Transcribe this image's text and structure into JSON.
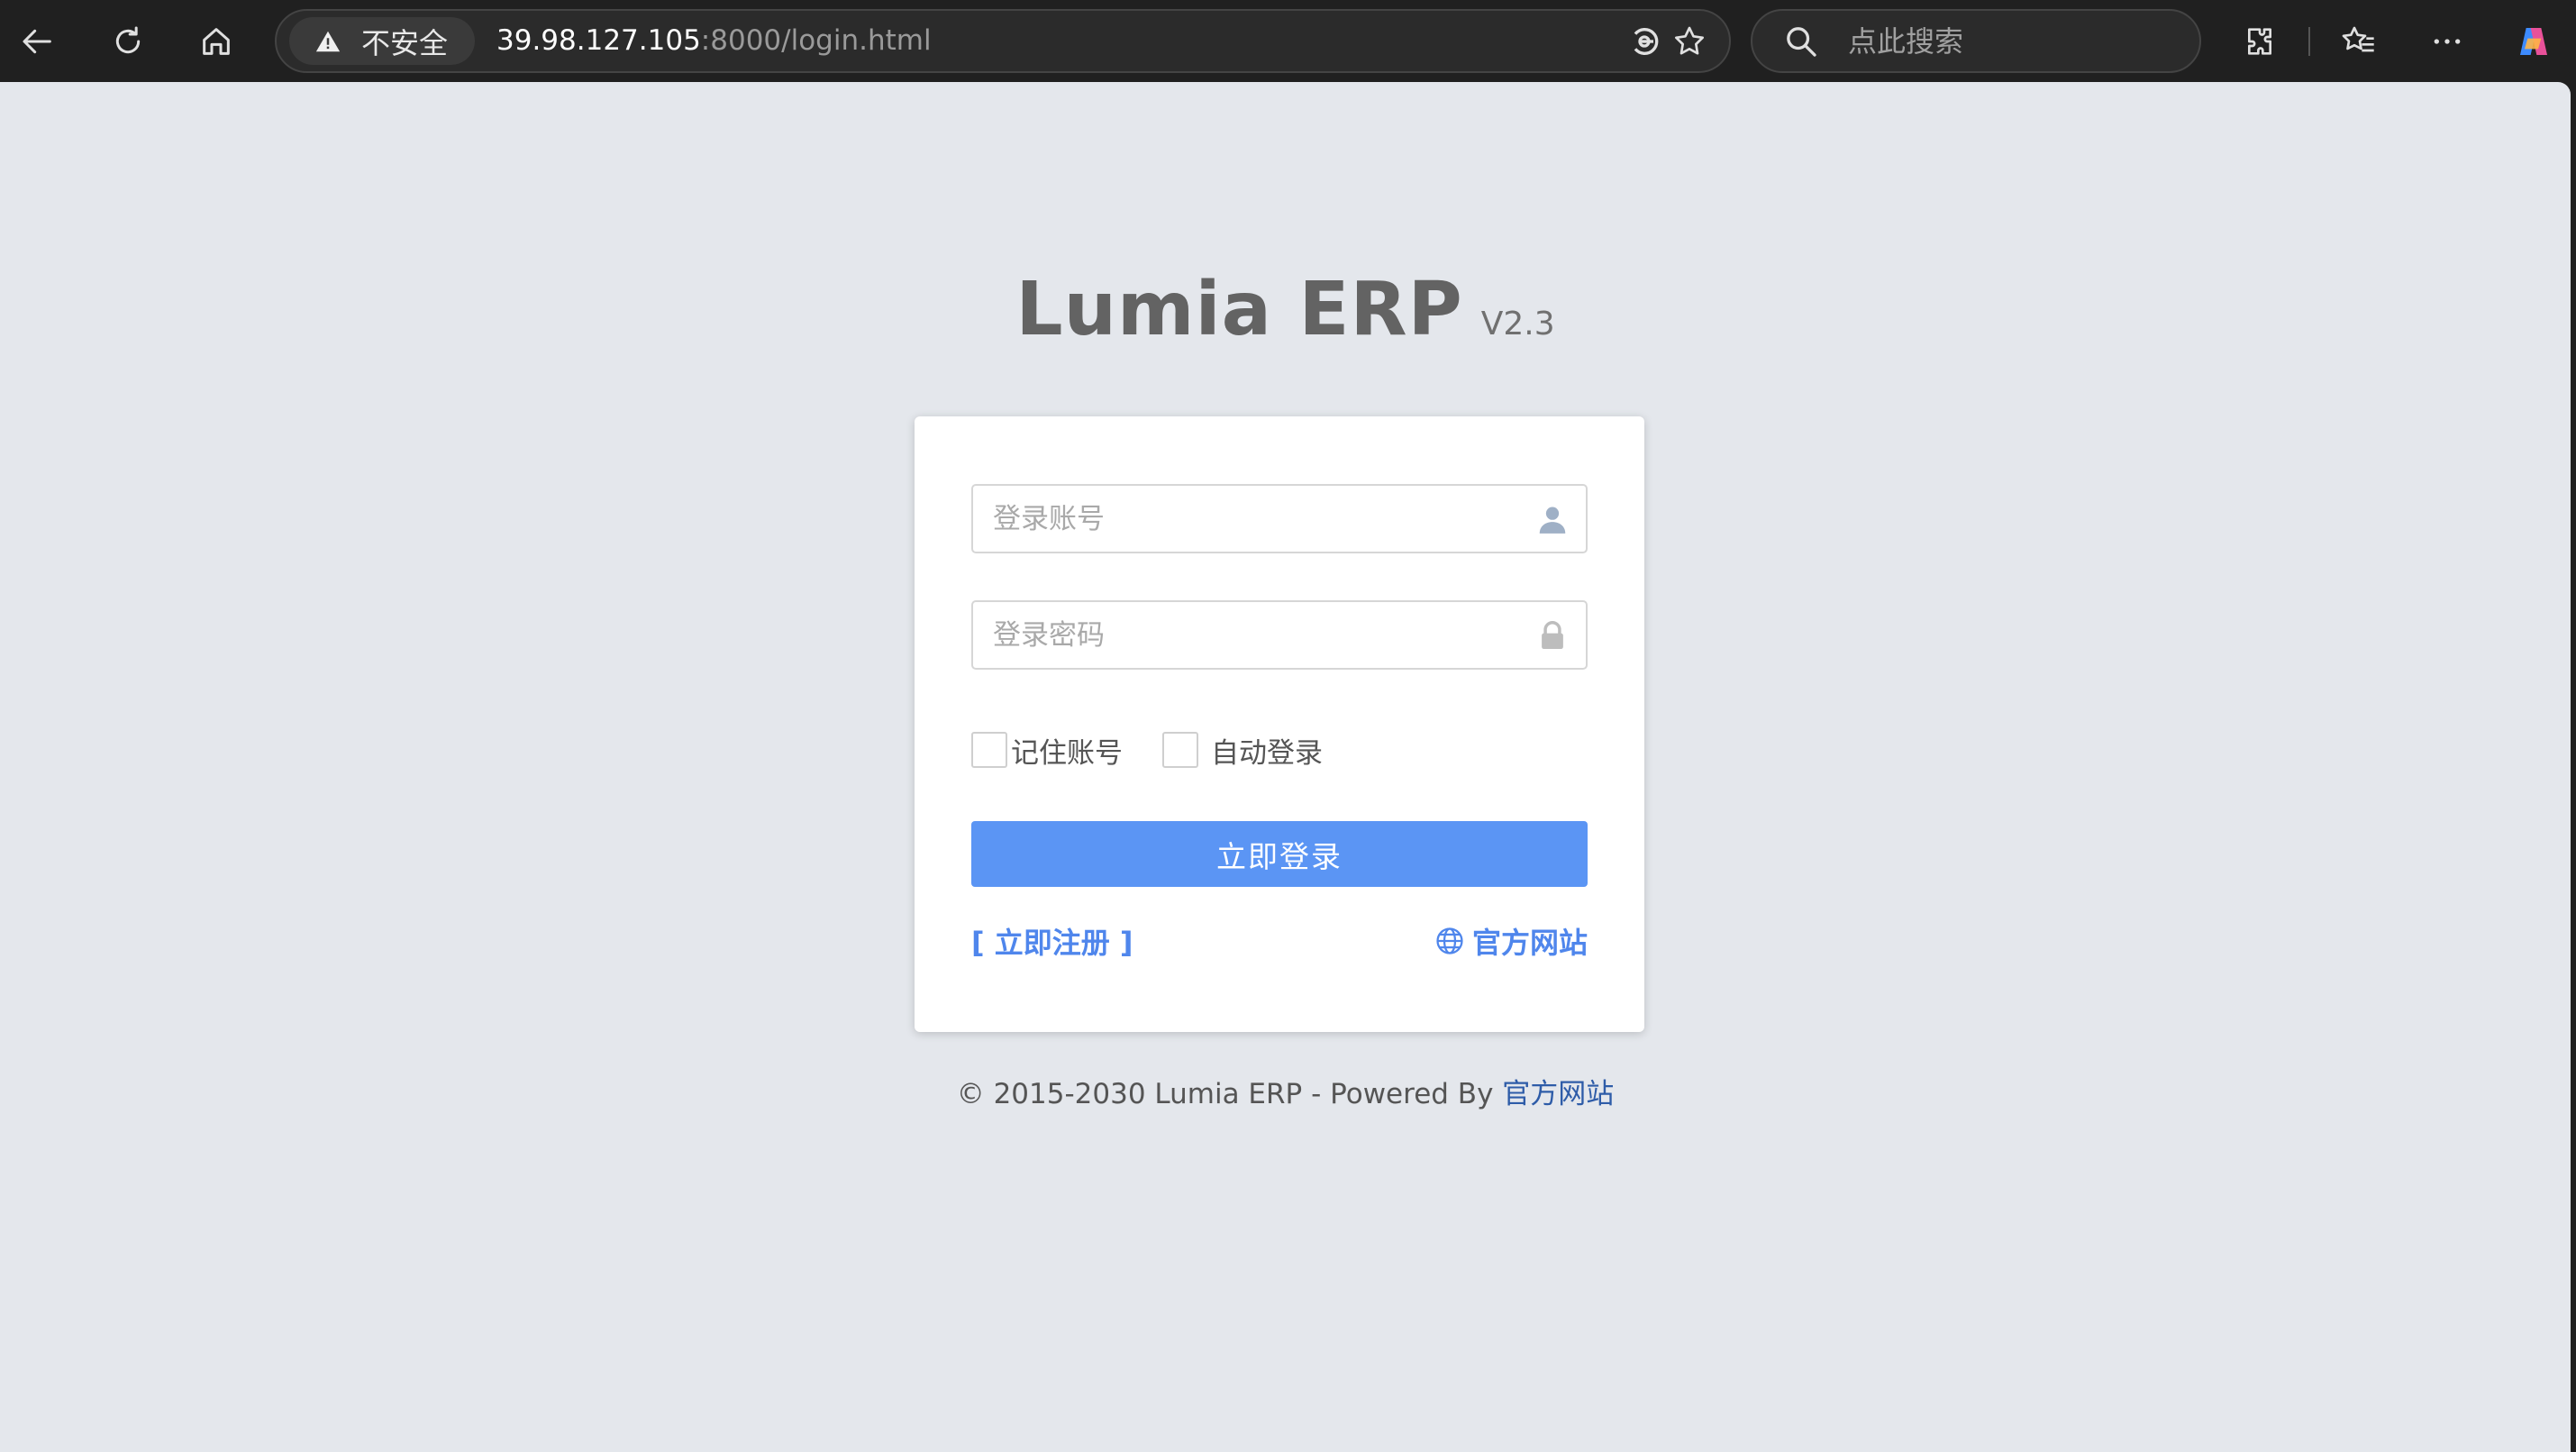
{
  "browser": {
    "security_label": "不安全",
    "url_host": "39.98.127.105",
    "url_rest": ":8000/login.html",
    "search_placeholder": "点此搜索",
    "icons": [
      "back-icon",
      "refresh-icon",
      "home-icon",
      "warning-icon",
      "read-aloud-icon",
      "favorite-star-icon",
      "search-icon",
      "extensions-icon",
      "favorites-icon",
      "more-icon",
      "copilot-icon"
    ]
  },
  "login": {
    "title": "Lumia ERP",
    "version": "V2.3",
    "account_placeholder": "登录账号",
    "password_placeholder": "登录密码",
    "remember_label": "记住账号",
    "auto_login_label": "自动登录",
    "submit_label": "立即登录",
    "register_link": "[ 立即注册 ]",
    "website_link": "官方网站"
  },
  "footer": {
    "copyright": "© 2015-2030 Lumia ERP - Powered By ",
    "link": "官方网站"
  },
  "colors": {
    "primary_button": "#5b95f4",
    "link": "#4f86ec",
    "page_background": "#e4e7ec"
  }
}
